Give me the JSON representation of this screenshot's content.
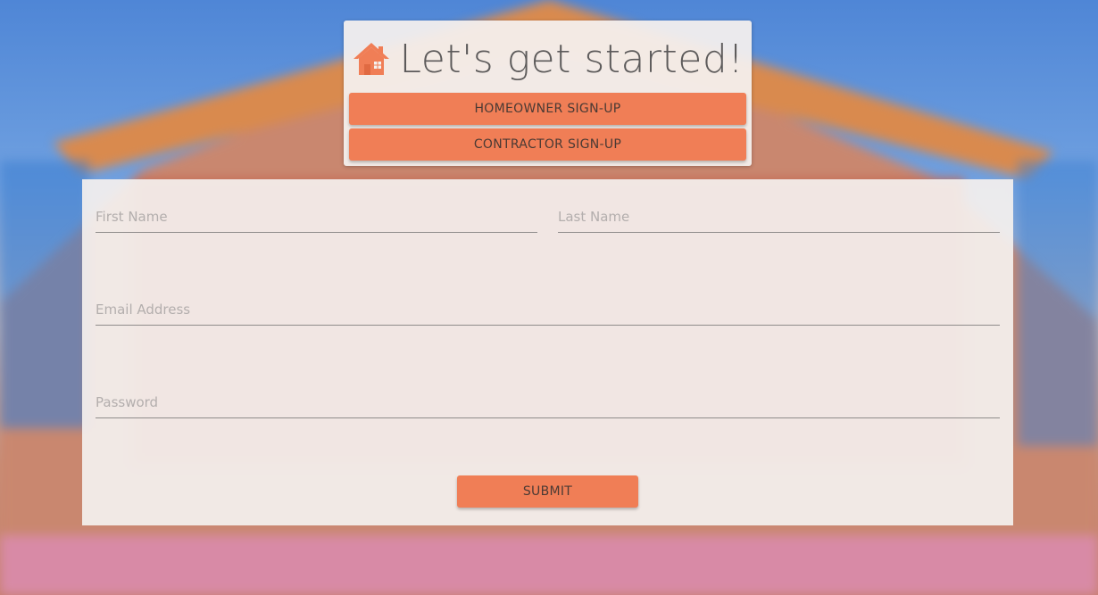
{
  "header": {
    "title": "Let's get started!",
    "icon": "house-icon",
    "homeowner_label": "HOMEOWNER SIGN-UP",
    "contractor_label": "CONTRACTOR SIGN-UP"
  },
  "form": {
    "first_name_placeholder": "First Name",
    "last_name_placeholder": "Last Name",
    "email_placeholder": "Email Address",
    "password_placeholder": "Password",
    "submit_label": "SUBMIT"
  },
  "colors": {
    "accent": "#f07e56",
    "title_text": "#5c5a5a",
    "panel": "#f4f0ee"
  }
}
